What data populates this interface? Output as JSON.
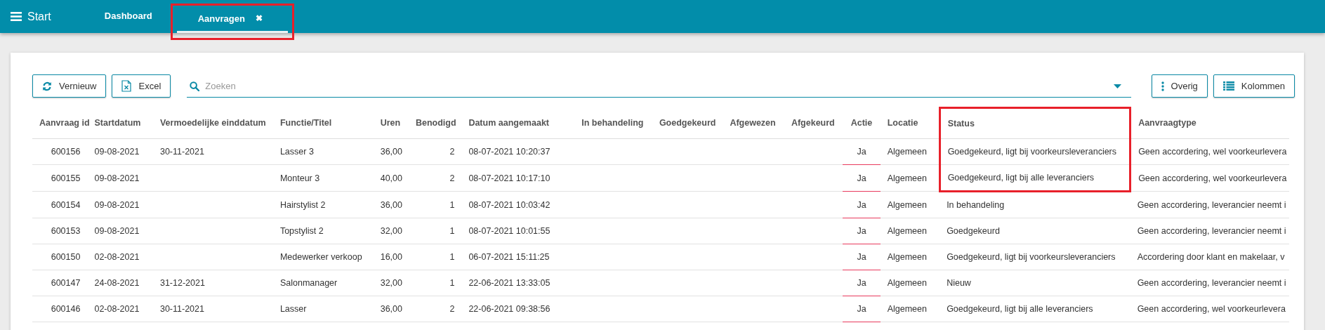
{
  "app_bar": {
    "menu_label": "Start",
    "tabs": [
      {
        "label": "Dashboard",
        "selected": false,
        "closable": false,
        "highlighted": false
      },
      {
        "label": "Aanvragen",
        "selected": true,
        "closable": true,
        "close_label": "✖",
        "highlighted": true
      }
    ]
  },
  "toolbar": {
    "left_buttons": [
      {
        "label": "Vernieuw"
      },
      {
        "label": "Excel"
      }
    ],
    "search": {
      "placeholder": "Zoeken"
    },
    "right_buttons": [
      {
        "label": "Overig"
      },
      {
        "label": "Kolommen"
      }
    ]
  },
  "table": {
    "columns": [
      {
        "label": "Aanvraag id",
        "kind": "text",
        "highlighted": false
      },
      {
        "label": "Startdatum",
        "kind": "text",
        "highlighted": false
      },
      {
        "label": "Vermoedelijke einddatum",
        "kind": "text",
        "highlighted": false
      },
      {
        "label": "Functie/Titel",
        "kind": "text",
        "highlighted": false
      },
      {
        "label": "Uren",
        "kind": "text",
        "highlighted": false
      },
      {
        "label": "Benodigd",
        "kind": "text",
        "highlighted": false
      },
      {
        "label": "Datum aangemaakt",
        "kind": "text",
        "highlighted": false
      },
      {
        "label": "In behandeling",
        "kind": "text",
        "highlighted": false
      },
      {
        "label": "Goedgekeurd",
        "kind": "text",
        "highlighted": false
      },
      {
        "label": "Afgewezen",
        "kind": "text",
        "highlighted": false
      },
      {
        "label": "Afgekeurd",
        "kind": "text",
        "highlighted": false
      },
      {
        "label": "Actie",
        "kind": "action",
        "highlighted": false
      },
      {
        "label": "Locatie",
        "kind": "text",
        "highlighted": false
      },
      {
        "label": "Status",
        "kind": "text",
        "highlighted": true
      },
      {
        "label": "Aanvraagtype",
        "kind": "text",
        "highlighted": false
      }
    ],
    "rows": [
      {
        "highlighted": true,
        "cells": [
          "600156",
          "09-08-2021",
          "30-11-2021",
          "Lasser 3",
          "36,00",
          "2",
          "08-07-2021 10:20:37",
          "",
          "",
          "",
          "",
          "Ja",
          "Algemeen",
          "Goedgekeurd, ligt bij voorkeursleveranciers",
          "Geen accordering, wel voorkeurlevera"
        ]
      },
      {
        "highlighted": true,
        "cells": [
          "600155",
          "09-08-2021",
          "",
          "Monteur 3",
          "40,00",
          "2",
          "08-07-2021 10:17:10",
          "",
          "",
          "",
          "",
          "Ja",
          "Algemeen",
          "Goedgekeurd, ligt bij alle leveranciers",
          "Geen accordering, wel voorkeurlevera"
        ]
      },
      {
        "highlighted": false,
        "cells": [
          "600154",
          "09-08-2021",
          "",
          "Hairstylist 2",
          "36,00",
          "1",
          "08-07-2021 10:03:42",
          "",
          "",
          "",
          "",
          "Ja",
          "Algemeen",
          "In behandeling",
          "Geen accordering, leverancier neemt i"
        ]
      },
      {
        "highlighted": false,
        "cells": [
          "600153",
          "09-08-2021",
          "",
          "Topstylist 2",
          "32,00",
          "1",
          "08-07-2021 10:01:55",
          "",
          "",
          "",
          "",
          "Ja",
          "Algemeen",
          "Goedgekeurd",
          "Geen accordering, leverancier neemt i"
        ]
      },
      {
        "highlighted": false,
        "cells": [
          "600150",
          "02-08-2021",
          "",
          "Medewerker verkoop",
          "16,00",
          "1",
          "06-07-2021 15:11:25",
          "",
          "",
          "",
          "",
          "Ja",
          "Algemeen",
          "Goedgekeurd, ligt bij voorkeursleveranciers",
          "Accordering door klant en makelaar, v"
        ]
      },
      {
        "highlighted": false,
        "cells": [
          "600147",
          "24-08-2021",
          "31-12-2021",
          "Salonmanager",
          "32,00",
          "1",
          "22-06-2021 13:33:05",
          "",
          "",
          "",
          "",
          "Ja",
          "Algemeen",
          "Nieuw",
          "Geen accordering, leverancier neemt i"
        ]
      },
      {
        "highlighted": false,
        "cells": [
          "600146",
          "02-08-2021",
          "30-11-2021",
          "Lasser",
          "36,00",
          "2",
          "22-06-2021 09:38:56",
          "",
          "",
          "",
          "",
          "Ja",
          "Algemeen",
          "Goedgekeurd, ligt bij alle leveranciers",
          "Geen accordering, wel voorkeurlevera"
        ]
      }
    ]
  }
}
